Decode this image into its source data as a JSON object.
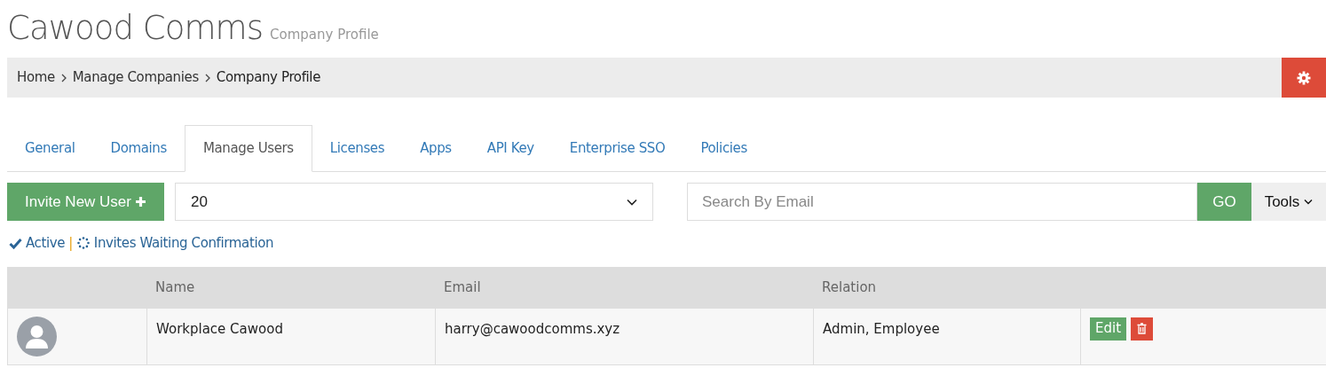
{
  "header": {
    "title": "Cawood Comms",
    "subtitle": "Company Profile"
  },
  "breadcrumb": [
    "Home",
    "Manage Companies",
    "Company Profile"
  ],
  "tabs": [
    {
      "label": "General",
      "selected": false
    },
    {
      "label": "Domains",
      "selected": false
    },
    {
      "label": "Manage Users",
      "selected": true
    },
    {
      "label": "Licenses",
      "selected": false
    },
    {
      "label": "Apps",
      "selected": false
    },
    {
      "label": "API Key",
      "selected": false
    },
    {
      "label": "Enterprise SSO",
      "selected": false
    },
    {
      "label": "Policies",
      "selected": false
    }
  ],
  "toolbar": {
    "invite_button": "Invite New User",
    "page_size": "20",
    "search": {
      "placeholder": "Search By Email"
    },
    "go_button": "GO",
    "tools_button": "Tools"
  },
  "legend": {
    "active": "Active",
    "separator": "|",
    "waiting": "Invites Waiting Confirmation"
  },
  "table": {
    "columns": [
      "Name",
      "Email",
      "Relation"
    ],
    "rows": [
      {
        "name": "Workplace Cawood",
        "email": "harry@cawoodcomms.xyz",
        "relation": "Admin, Employee",
        "edit": "Edit"
      }
    ]
  }
}
